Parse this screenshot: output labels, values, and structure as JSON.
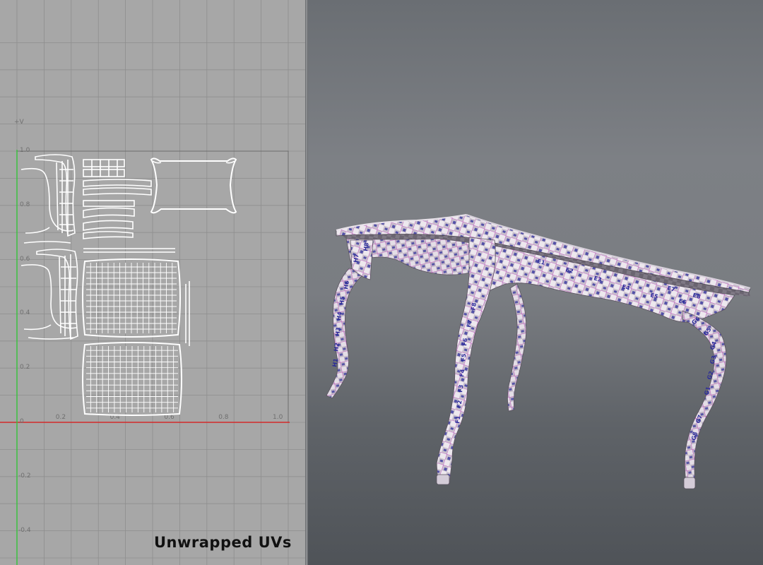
{
  "uv_editor": {
    "v_axis_label": "+V",
    "v_ticks": [
      "1.0",
      "0.8",
      "0.6",
      "0.4",
      "0.2",
      "0",
      "-0.2",
      "-0.4"
    ],
    "u_ticks": [
      "0.2",
      "0.4",
      "0.6",
      "0.8",
      "1.0"
    ],
    "caption": "Unwrapped UVs",
    "colors": {
      "u_axis": "#d42a2a",
      "v_axis": "#35c43a",
      "grid": "#8e8e8e",
      "uv_lines": "#ffffff"
    }
  },
  "viewport_3d": {
    "object": "table",
    "texture": "uv-checker",
    "checker_labels": [
      "F1",
      "F2",
      "F3",
      "F4",
      "F5",
      "F6",
      "F7",
      "F8",
      "G1",
      "G2",
      "G3",
      "G4",
      "G5",
      "G6",
      "G7",
      "G8",
      "H1",
      "H2",
      "H3",
      "H4",
      "H5",
      "H6",
      "H7",
      "H8",
      "E1",
      "E2",
      "E3",
      "E4",
      "E5",
      "E6",
      "E7",
      "E8"
    ]
  }
}
